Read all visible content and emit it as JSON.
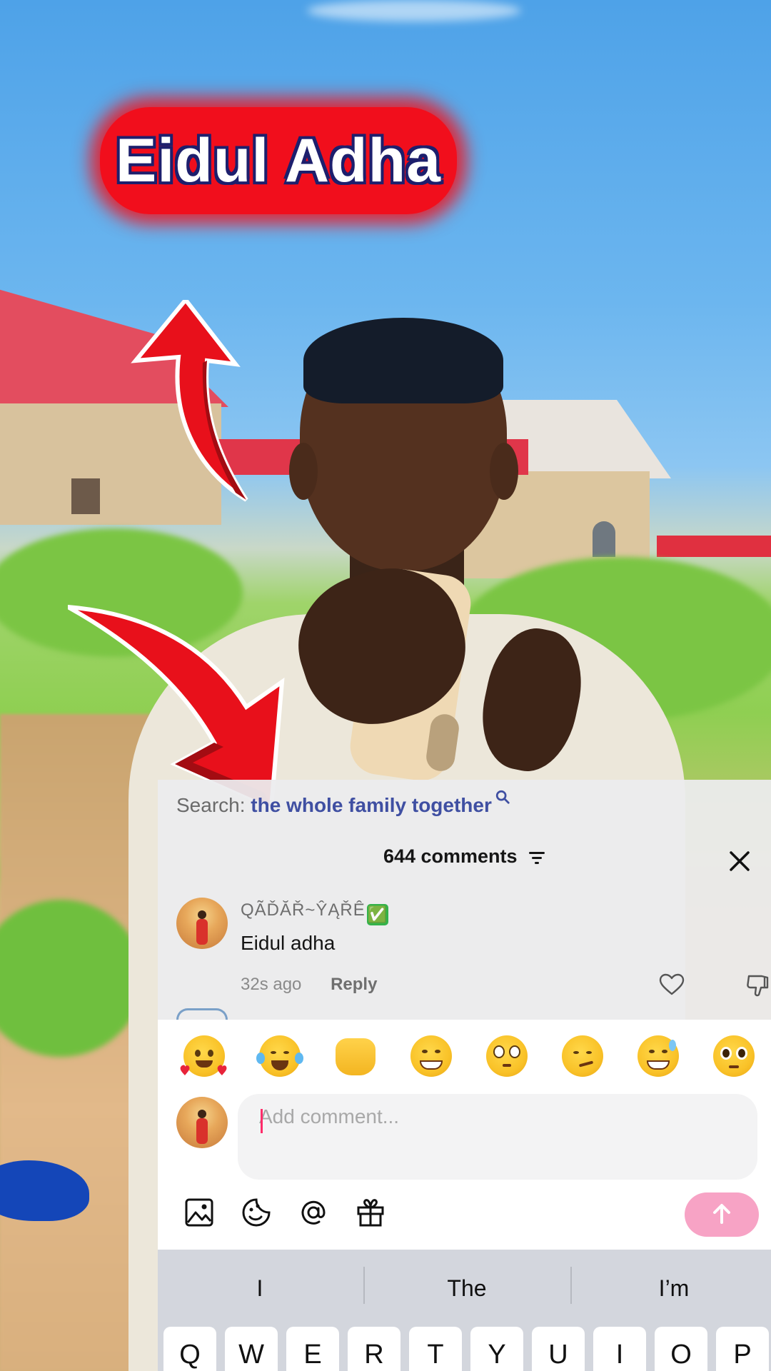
{
  "video": {
    "overlay_title": "Eidul Adha"
  },
  "comments_sheet": {
    "search_prefix": "Search:",
    "search_query": "the whole family together",
    "header": "644 comments",
    "comment": {
      "username": "QÃĎĂŘ~ŶĄŘÊ",
      "verified_emoji": "✅",
      "text": "Eidul adha",
      "time": "32s ago",
      "reply_label": "Reply"
    }
  },
  "composer": {
    "emojis": [
      "smiling-face-with-hearts",
      "face-with-tears-of-joy",
      "palms-up-together",
      "beaming-face",
      "flushed-face",
      "smirking-face",
      "grinning-face-with-sweat",
      "pleading-face"
    ],
    "input_placeholder": "Add comment...",
    "send_color": "#f7a3c5"
  },
  "keyboard": {
    "suggestions": [
      "I",
      "The",
      "I’m"
    ],
    "row1": [
      "Q",
      "W",
      "E",
      "R",
      "T",
      "Y",
      "U",
      "I",
      "O",
      "P"
    ]
  },
  "colors": {
    "accent": "#fe2c6a",
    "title_red": "#f10e1c",
    "search_query": "#3f4fa2"
  }
}
